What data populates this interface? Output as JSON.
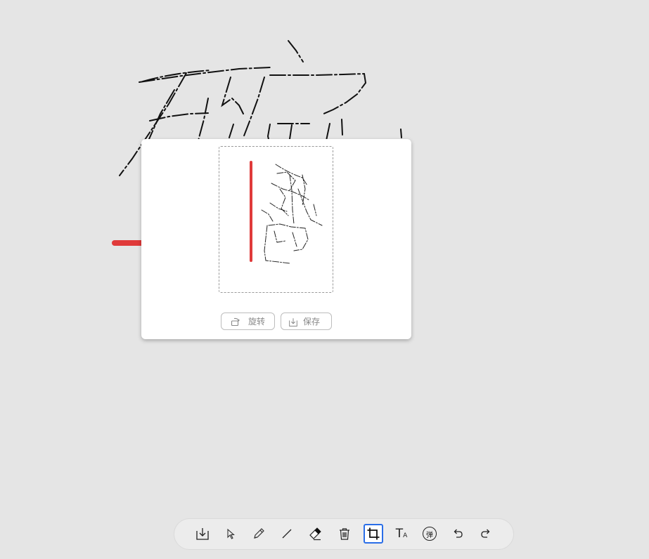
{
  "preview_panel": {
    "rotate_label": "旋转",
    "save_label": "保存"
  },
  "toolbar": {
    "active_tool": "crop",
    "tools": [
      {
        "name": "download-icon"
      },
      {
        "name": "select-cursor-icon"
      },
      {
        "name": "pencil-icon"
      },
      {
        "name": "line-icon"
      },
      {
        "name": "eraser-icon"
      },
      {
        "name": "trash-icon"
      },
      {
        "name": "crop-icon"
      },
      {
        "name": "text-icon",
        "glyph_main": "T",
        "glyph_sub": "A"
      },
      {
        "name": "danmaku-icon",
        "glyph": "弹"
      },
      {
        "name": "undo-icon"
      },
      {
        "name": "redo-icon"
      }
    ]
  },
  "colors": {
    "background": "#e5e5e5",
    "stroke": "#111111",
    "marker_red": "#e03a3a",
    "active_border": "#2a6ee8"
  }
}
